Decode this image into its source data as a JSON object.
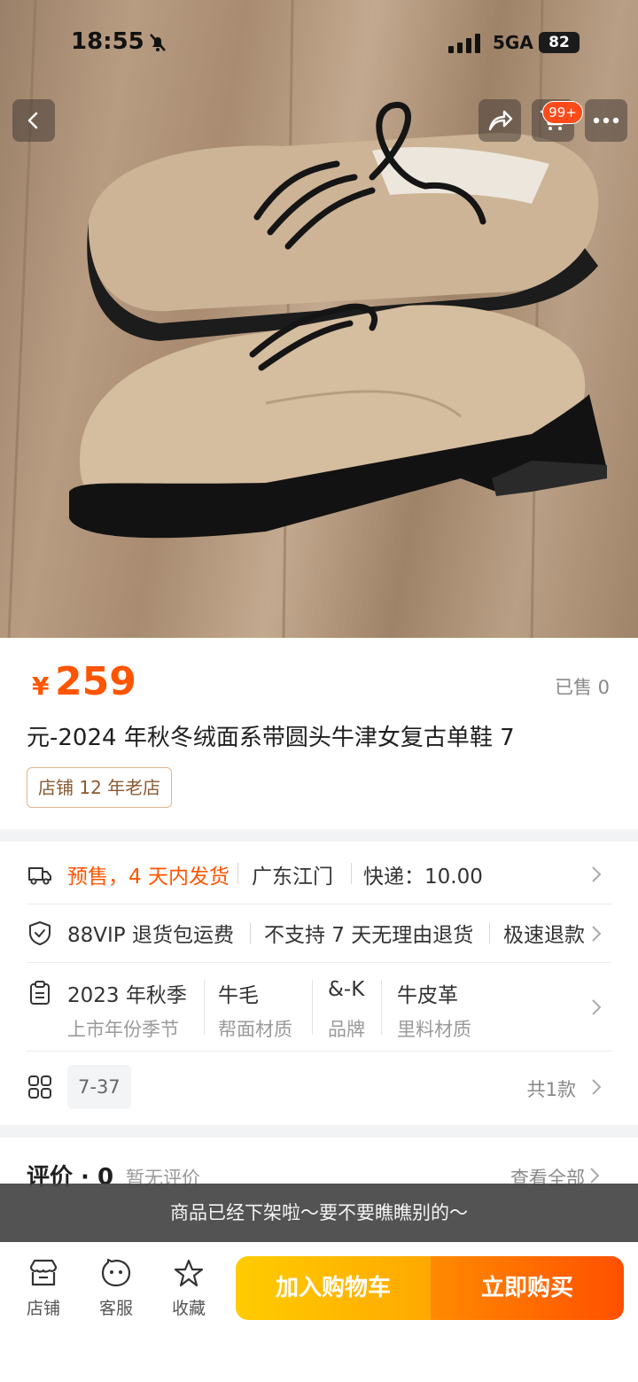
{
  "status_bar": {
    "time": "18:55",
    "network": "5GA",
    "battery": "82"
  },
  "header": {
    "cart_badge": "99+"
  },
  "product": {
    "price_symbol": "¥",
    "price": "259",
    "sold": "已售 0",
    "title": "元-2024 年秋冬绒面系带圆头牛津女复古单鞋 7",
    "shop_tag": "店铺 12 年老店"
  },
  "shipping": {
    "presale": "预售，4 天内发货",
    "location": "广东江门",
    "express": "快递：10.00"
  },
  "services": [
    "88VIP 退货包运费",
    "不支持 7 天无理由退货",
    "极速退款"
  ],
  "attributes": [
    {
      "value": "2023 年秋季",
      "key": "上市年份季节"
    },
    {
      "value": "牛毛",
      "key": "帮面材质"
    },
    {
      "value": "&-K",
      "key": "品牌"
    },
    {
      "value": "牛皮革",
      "key": "里料材质"
    }
  ],
  "spec": {
    "chip": "7-37",
    "count": "共1款"
  },
  "reviews": {
    "title": "评价 · 0",
    "empty": "暂无评价",
    "view_all": "查看全部"
  },
  "toast": "商品已经下架啦～要不要瞧瞧别的～",
  "bottom_bar": {
    "shop": "店铺",
    "service": "客服",
    "favorite": "收藏",
    "add_cart": "加入购物车",
    "buy_now": "立即购买"
  },
  "colors": {
    "accent": "#ff5500",
    "cart_start": "#ffcc00",
    "buy_end": "#ff5000"
  }
}
